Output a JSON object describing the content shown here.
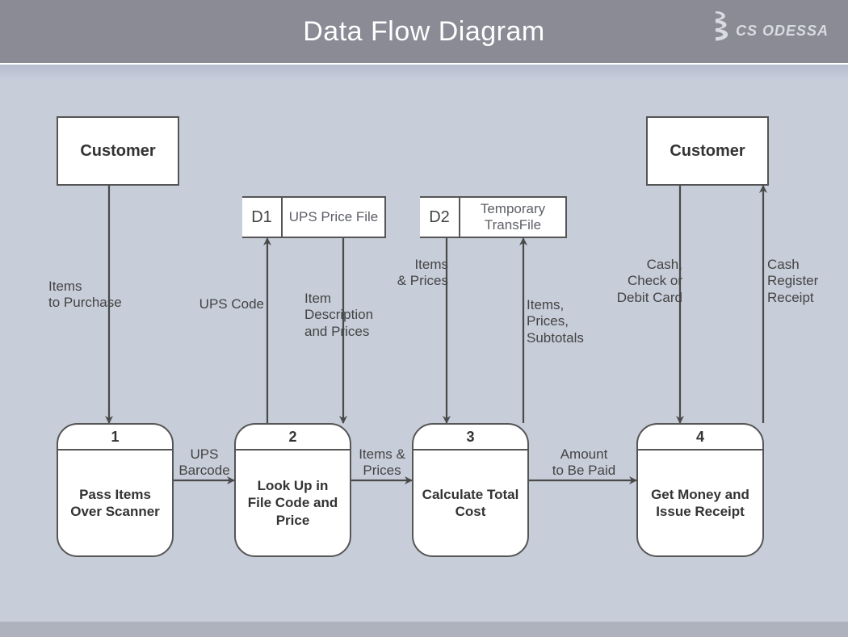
{
  "header": {
    "title": "Data Flow Diagram",
    "brand": "CS ODESSA"
  },
  "entities": {
    "customer_left": "Customer",
    "customer_right": "Customer"
  },
  "stores": {
    "d1": {
      "id": "D1",
      "name": "UPS Price File"
    },
    "d2": {
      "id": "D2",
      "name": "Temporary TransFile"
    }
  },
  "processes": {
    "p1": {
      "num": "1",
      "name": "Pass Items Over Scanner"
    },
    "p2": {
      "num": "2",
      "name": "Look Up in File Code and Price"
    },
    "p3": {
      "num": "3",
      "name": "Calculate Total Cost"
    },
    "p4": {
      "num": "4",
      "name": "Get Money and Issue Receipt"
    }
  },
  "flows": {
    "items_to_purchase": "Items\nto Purchase",
    "ups_code": "UPS Code",
    "item_desc_prices": "Item\nDescription\nand Prices",
    "ups_barcode": "UPS\nBarcode",
    "items_and_prices_top": "Items\n& Prices",
    "items_prices_subtotals": "Items,\nPrices,\nSubtotals",
    "items_and_prices_mid": "Items &\nPrices",
    "amount_to_be_paid": "Amount\nto Be Paid",
    "cash_check_debit": "Cash,\nCheck or\nDebit Card",
    "cash_register_receipt": "Cash\nRegister\nReceipt"
  }
}
